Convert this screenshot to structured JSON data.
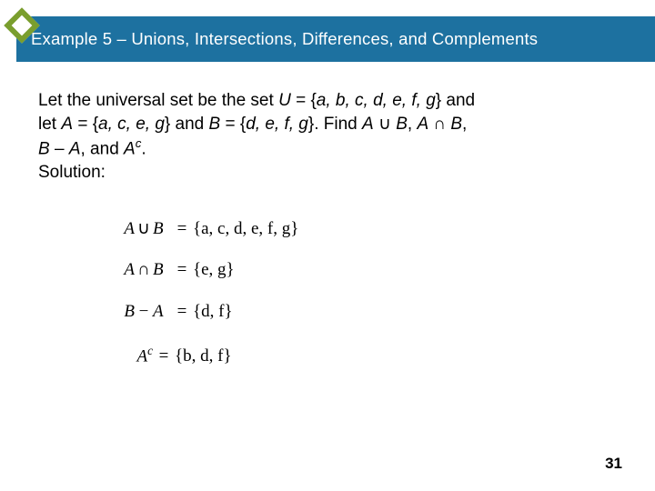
{
  "header": {
    "title": "Example 5 – Unions, Intersections, Differences, and Complements"
  },
  "body": {
    "line1_a": "Let the universal set be the set ",
    "line1_U": "U",
    "line1_b": " = {",
    "line1_elems": "a, b, c, d, e, f, g",
    "line1_c": "} and",
    "line2_a": "let ",
    "line2_A": "A",
    "line2_b": " = {",
    "line2_Aelems": "a, c, e, g",
    "line2_c": "} and ",
    "line2_B": "B",
    "line2_d": " = {",
    "line2_Belems": "d, e, f, g",
    "line2_e": "}. Find ",
    "line2_f": "A",
    "line2_un": " ∪ ",
    "line2_g": "B",
    "line2_h": ", ",
    "line2_i": "A",
    "line2_in": " ∩ ",
    "line2_j": "B",
    "line2_k": ",",
    "line3_a": "B",
    "line3_b": " – ",
    "line3_c": "A",
    "line3_d": ", and ",
    "line3_e": "A",
    "line3_sup": "c",
    "line3_f": "."
  },
  "solution_label": "Solution:",
  "eqns": {
    "r1": {
      "A": "A",
      "op": "∪",
      "B": "B",
      "set": "{a, c, d, e, f, g}"
    },
    "r2": {
      "A": "A",
      "op": "∩",
      "B": "B",
      "set": "{e, g}"
    },
    "r3": {
      "A": "B",
      "op": "−",
      "B": "A",
      "set": "{d, f}"
    },
    "r4": {
      "A": "A",
      "sup": "c",
      "set": "{b, d, f}"
    }
  },
  "slide_number": "31"
}
